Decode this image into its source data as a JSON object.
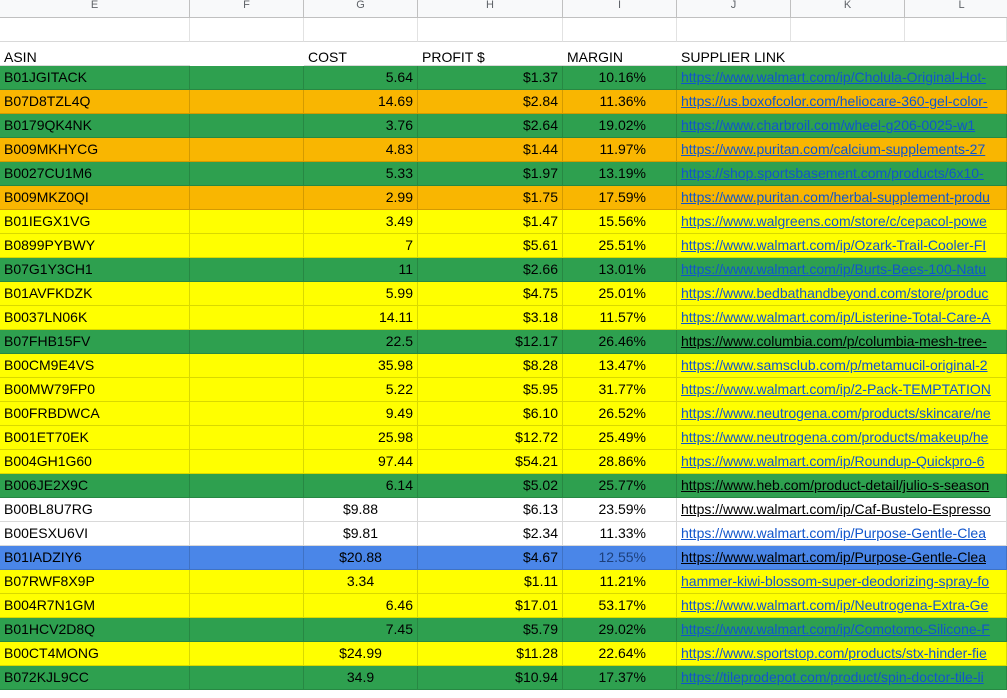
{
  "column_letters": [
    "E",
    "F",
    "G",
    "H",
    "I",
    "J",
    "K",
    "L"
  ],
  "header": {
    "asin": "ASIN",
    "cost": "COST",
    "profit": "PROFIT $",
    "margin": "MARGIN",
    "supplier_link": "SUPPLIER LINK"
  },
  "row_colors": {
    "green": "#2ea04f",
    "orange": "#f9b601",
    "yellow": "#ffff00",
    "white": "#ffffff",
    "blue": "#4a86e8",
    "link": "#1155cc"
  },
  "rows": [
    {
      "color": "green",
      "asin": "B01JGITACK",
      "cost": "5.64",
      "profit": "$1.37",
      "margin": "10.16%",
      "link": "https://www.walmart.com/ip/Cholula-Original-Hot-"
    },
    {
      "color": "orange",
      "asin": "B07D8TZL4Q",
      "cost": "14.69",
      "profit": "$2.84",
      "margin": "11.36%",
      "link": "https://us.boxofcolor.com/heliocare-360-gel-color-"
    },
    {
      "color": "green",
      "asin": "B0179QK4NK",
      "cost": "3.76",
      "profit": "$2.64",
      "margin": "19.02%",
      "link": "https://www.charbroil.com/wheel-g206-0025-w1"
    },
    {
      "color": "orange",
      "asin": "B009MKHYCG",
      "cost": "4.83",
      "profit": "$1.44",
      "margin": "11.97%",
      "link": "https://www.puritan.com/calcium-supplements-27"
    },
    {
      "color": "green",
      "asin": "B0027CU1M6",
      "cost": "5.33",
      "profit": "$1.97",
      "margin": "13.19%",
      "link": "https://shop.sportsbasement.com/products/6x10-"
    },
    {
      "color": "orange",
      "asin": "B009MKZ0QI",
      "cost": "2.99",
      "profit": "$1.75",
      "margin": "17.59%",
      "link": "https://www.puritan.com/herbal-supplement-produ"
    },
    {
      "color": "yellow",
      "asin": "B01IEGX1VG",
      "cost": "3.49",
      "profit": "$1.47",
      "margin": "15.56%",
      "link": "https://www.walgreens.com/store/c/cepacol-powe"
    },
    {
      "color": "yellow",
      "asin": "B0899PYBWY",
      "cost": "7",
      "profit": "$5.61",
      "margin": "25.51%",
      "link": "https://www.walmart.com/ip/Ozark-Trail-Cooler-FI"
    },
    {
      "color": "green",
      "asin": "B07G1Y3CH1",
      "cost": "11",
      "profit": "$2.66",
      "margin": "13.01%",
      "link": "https://www.walmart.com/ip/Burts-Bees-100-Natu"
    },
    {
      "color": "yellow",
      "asin": "B01AVFKDZK",
      "cost": "5.99",
      "profit": "$4.75",
      "margin": "25.01%",
      "link": "https://www.bedbathandbeyond.com/store/produc"
    },
    {
      "color": "yellow",
      "asin": "B0037LN06K",
      "cost": "14.11",
      "profit": "$3.18",
      "margin": "11.57%",
      "link": "https://www.walmart.com/ip/Listerine-Total-Care-A"
    },
    {
      "color": "green",
      "asin": "B07FHB15FV",
      "cost": "22.5",
      "profit": "$12.17",
      "margin": "26.46%",
      "link": "https://www.columbia.com/p/columbia-mesh-tree-",
      "dark": true
    },
    {
      "color": "yellow",
      "asin": "B00CM9E4VS",
      "cost": "35.98",
      "profit": "$8.28",
      "margin": "13.47%",
      "link": "https://www.samsclub.com/p/metamucil-original-2"
    },
    {
      "color": "yellow",
      "asin": "B00MW79FP0",
      "cost": "5.22",
      "profit": "$5.95",
      "margin": "31.77%",
      "link": "https://www.walmart.com/ip/2-Pack-TEMPTATION"
    },
    {
      "color": "yellow",
      "asin": "B00FRBDWCA",
      "cost": "9.49",
      "profit": "$6.10",
      "margin": "26.52%",
      "link": "https://www.neutrogena.com/products/skincare/ne"
    },
    {
      "color": "yellow",
      "asin": "B001ET70EK",
      "cost": "25.98",
      "profit": "$12.72",
      "margin": "25.49%",
      "link": "https://www.neutrogena.com/products/makeup/he"
    },
    {
      "color": "yellow",
      "asin": "B004GH1G60",
      "cost": "97.44",
      "profit": "$54.21",
      "margin": "28.86%",
      "link": "https://www.walmart.com/ip/Roundup-Quickpro-6"
    },
    {
      "color": "green",
      "asin": "B006JE2X9C",
      "cost": "6.14",
      "profit": "$5.02",
      "margin": "25.77%",
      "link": "https://www.heb.com/product-detail/julio-s-season",
      "dark": true
    },
    {
      "color": "white",
      "asin": "B00BL8U7RG",
      "cost": "$9.88",
      "costAlign": "c",
      "profit": "$6.13",
      "margin": "23.59%",
      "link": "https://www.walmart.com/ip/Caf-Bustelo-Espresso",
      "dark": true
    },
    {
      "color": "white",
      "asin": "B00ESXU6VI",
      "cost": "$9.81",
      "costAlign": "c",
      "profit": "$2.34",
      "margin": "11.33%",
      "link": "https://www.walmart.com/ip/Purpose-Gentle-Clea"
    },
    {
      "color": "blue",
      "asin": "B01IADZIY6",
      "cost": "$20.88",
      "costAlign": "c",
      "profit": "$4.67",
      "margin": "12.55%",
      "link": "https://www.walmart.com/ip/Purpose-Gentle-Clea",
      "dark": true
    },
    {
      "color": "yellow",
      "asin": "B07RWF8X9P",
      "cost": "3.34",
      "costAlign": "c",
      "profit": "$1.11",
      "margin": "11.21%",
      "link": "hammer-kiwi-blossom-super-deodorizing-spray-fo"
    },
    {
      "color": "yellow",
      "asin": "B004R7N1GM",
      "cost": "6.46",
      "profit": "$17.01",
      "margin": "53.17%",
      "link": "https://www.walmart.com/ip/Neutrogena-Extra-Ge"
    },
    {
      "color": "green",
      "asin": "B01HCV2D8Q",
      "cost": "7.45",
      "profit": "$5.79",
      "margin": "29.02%",
      "link": "https://www.walmart.com/ip/Comotomo-Silicone-F"
    },
    {
      "color": "yellow",
      "asin": "B00CT4MONG",
      "cost": "$24.99",
      "costAlign": "c",
      "profit": "$11.28",
      "margin": "22.64%",
      "link": "https://www.sportstop.com/products/stx-hinder-fie"
    },
    {
      "color": "green",
      "asin": "B072KJL9CC",
      "cost": "34.9",
      "costAlign": "c",
      "profit": "$10.94",
      "margin": "17.37%",
      "link": "https://tileprodepot.com/product/spin-doctor-tile-li"
    }
  ]
}
